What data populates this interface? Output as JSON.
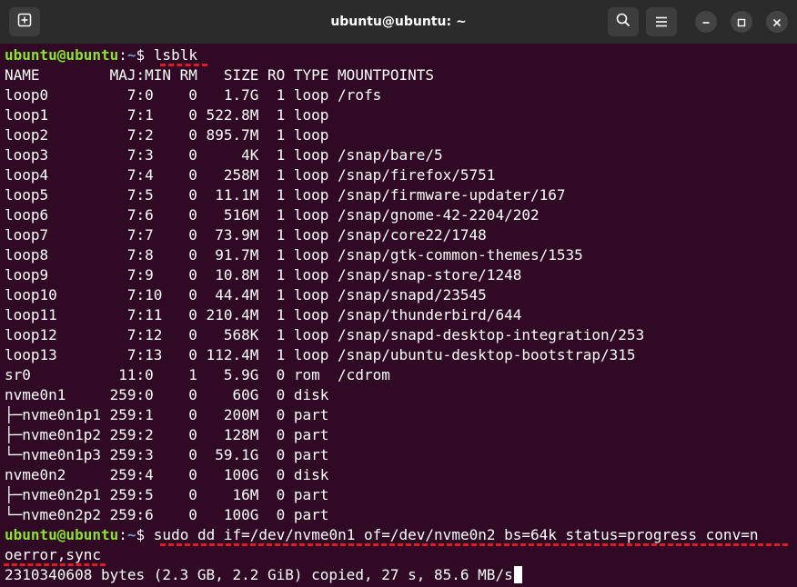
{
  "window": {
    "title": "ubuntu@ubuntu: ~"
  },
  "prompt": {
    "user_host": "ubuntu@ubuntu",
    "separator": ":",
    "path": "~",
    "symbol": "$"
  },
  "commands": {
    "lsblk": "lsblk",
    "dd_line1": "sudo dd if=/dev/nvme0n1 of=/dev/nvme0n2 bs=64k status=progress conv=n",
    "dd_line2": "oerror,sync"
  },
  "lsblk_output": [
    "NAME        MAJ:MIN RM   SIZE RO TYPE MOUNTPOINTS",
    "loop0         7:0    0   1.7G  1 loop /rofs",
    "loop1         7:1    0 522.8M  1 loop",
    "loop2         7:2    0 895.7M  1 loop",
    "loop3         7:3    0     4K  1 loop /snap/bare/5",
    "loop4         7:4    0   258M  1 loop /snap/firefox/5751",
    "loop5         7:5    0  11.1M  1 loop /snap/firmware-updater/167",
    "loop6         7:6    0   516M  1 loop /snap/gnome-42-2204/202",
    "loop7         7:7    0  73.9M  1 loop /snap/core22/1748",
    "loop8         7:8    0  91.7M  1 loop /snap/gtk-common-themes/1535",
    "loop9         7:9    0  10.8M  1 loop /snap/snap-store/1248",
    "loop10        7:10   0  44.4M  1 loop /snap/snapd/23545",
    "loop11        7:11   0 210.4M  1 loop /snap/thunderbird/644",
    "loop12        7:12   0   568K  1 loop /snap/snapd-desktop-integration/253",
    "loop13        7:13   0 112.4M  1 loop /snap/ubuntu-desktop-bootstrap/315",
    "sr0          11:0    1   5.9G  0 rom  /cdrom",
    "nvme0n1     259:0    0    60G  0 disk",
    "├─nvme0n1p1 259:1    0   200M  0 part",
    "├─nvme0n1p2 259:2    0   128M  0 part",
    "└─nvme0n1p3 259:3    0  59.1G  0 part",
    "nvme0n2     259:4    0   100G  0 disk",
    "├─nvme0n2p1 259:5    0    16M  0 part",
    "└─nvme0n2p2 259:6    0   100G  0 part"
  ],
  "progress_output": "2310340608 bytes (2.3 GB, 2.2 GiB) copied, 27 s, 85.6 MB/s",
  "icons": {
    "new_tab": "new-tab-icon",
    "search": "search-icon",
    "menu": "hamburger-menu-icon",
    "minimize": "minimize-icon",
    "maximize": "maximize-icon",
    "close": "close-icon"
  },
  "colors": {
    "background": "#300a24",
    "titlebar": "#2b2b2b",
    "prompt_user": "#8ae234",
    "prompt_path": "#729fcf",
    "annotation": "#e01b24"
  }
}
